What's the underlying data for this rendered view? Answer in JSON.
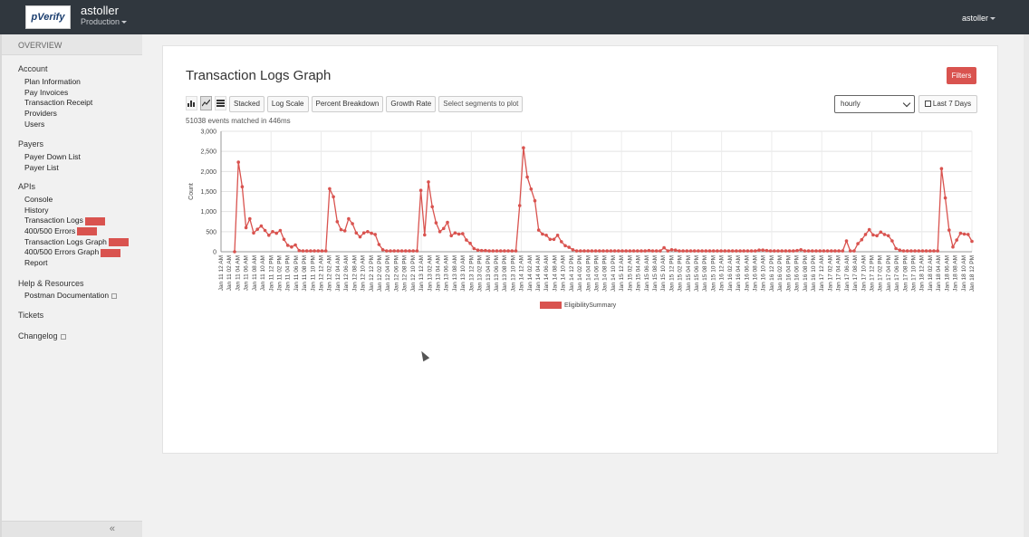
{
  "header": {
    "logo_text": "pVerify",
    "account_name": "astoller",
    "environment": "Production",
    "user_name": "astoller"
  },
  "sidebar": {
    "overview": "OVERVIEW",
    "account": {
      "title": "Account",
      "items": [
        "Plan Information",
        "Pay Invoices",
        "Transaction Receipt",
        "Providers",
        "Users"
      ]
    },
    "payers": {
      "title": "Payers",
      "items": [
        "Payer Down List",
        "Payer List"
      ]
    },
    "apis": {
      "title": "APIs",
      "items": [
        "Console",
        "History",
        "Transaction Logs",
        "400/500 Errors",
        "Transaction Logs Graph",
        "400/500 Errors Graph",
        "Report"
      ]
    },
    "help": {
      "title": "Help & Resources",
      "items": [
        "Postman Documentation"
      ]
    },
    "tickets": "Tickets",
    "changelog": "Changelog",
    "collapse": "«"
  },
  "main": {
    "title": "Transaction Logs Graph",
    "filters_label": "Filters",
    "toolbar": {
      "stacked": "Stacked",
      "log_scale": "Log Scale",
      "percent_breakdown": "Percent Breakdown",
      "growth_rate": "Growth Rate",
      "select_segments": "Select segments to plot"
    },
    "matched_text": "51038 events matched in 446ms",
    "interval": "hourly",
    "range": "Last 7 Days"
  },
  "chart_data": {
    "type": "line",
    "ylabel": "Count",
    "ylim": [
      0,
      3000
    ],
    "yticks": [
      "0",
      "500",
      "1,000",
      "1,500",
      "2,000",
      "2,500",
      "3,000"
    ],
    "grid": true,
    "legend_position": "bottom-center",
    "colors": {
      "series": "#d9534f"
    },
    "x_tick_labels": [
      "Jan 11 12 AM",
      "Jan 11 02 AM",
      "Jan 11 04 AM",
      "Jan 11 06 AM",
      "Jan 11 08 AM",
      "Jan 11 10 AM",
      "Jan 11 12 PM",
      "Jan 11 02 PM",
      "Jan 11 04 PM",
      "Jan 11 06 PM",
      "Jan 11 08 PM",
      "Jan 11 10 PM",
      "Jan 12 12 AM",
      "Jan 12 02 AM",
      "Jan 12 04 AM",
      "Jan 12 06 AM",
      "Jan 12 08 AM",
      "Jan 12 10 AM",
      "Jan 12 12 PM",
      "Jan 12 02 PM",
      "Jan 12 04 PM",
      "Jan 12 06 PM",
      "Jan 12 08 PM",
      "Jan 12 10 PM",
      "Jan 13 12 AM",
      "Jan 13 02 AM",
      "Jan 13 04 AM",
      "Jan 13 06 AM",
      "Jan 13 08 AM",
      "Jan 13 10 AM",
      "Jan 13 12 PM",
      "Jan 13 02 PM",
      "Jan 13 04 PM",
      "Jan 13 06 PM",
      "Jan 13 08 PM",
      "Jan 13 10 PM",
      "Jan 14 12 AM",
      "Jan 14 02 AM",
      "Jan 14 04 AM",
      "Jan 14 06 AM",
      "Jan 14 08 AM",
      "Jan 14 10 AM",
      "Jan 14 12 PM",
      "Jan 14 02 PM",
      "Jan 14 04 PM",
      "Jan 14 06 PM",
      "Jan 14 08 PM",
      "Jan 14 10 PM",
      "Jan 15 12 AM",
      "Jan 15 02 AM",
      "Jan 15 04 AM",
      "Jan 15 06 AM",
      "Jan 15 08 AM",
      "Jan 15 10 AM",
      "Jan 15 12 PM",
      "Jan 15 02 PM",
      "Jan 15 04 PM",
      "Jan 15 06 PM",
      "Jan 15 08 PM",
      "Jan 15 10 PM",
      "Jan 16 12 AM",
      "Jan 16 02 AM",
      "Jan 16 04 AM",
      "Jan 16 06 AM",
      "Jan 16 08 AM",
      "Jan 16 10 AM",
      "Jan 16 12 PM",
      "Jan 16 02 PM",
      "Jan 16 04 PM",
      "Jan 16 06 PM",
      "Jan 16 08 PM",
      "Jan 16 10 PM",
      "Jan 17 12 AM",
      "Jan 17 02 AM",
      "Jan 17 04 AM",
      "Jan 17 06 AM",
      "Jan 17 08 AM",
      "Jan 17 10 AM",
      "Jan 17 12 PM",
      "Jan 17 02 PM",
      "Jan 17 04 PM",
      "Jan 17 06 PM",
      "Jan 17 08 PM",
      "Jan 17 10 PM",
      "Jan 18 12 AM",
      "Jan 18 02 AM",
      "Jan 18 04 AM",
      "Jan 18 06 AM",
      "Jan 18 08 AM",
      "Jan 18 10 AM",
      "Jan 18 12 PM"
    ],
    "series": [
      {
        "name": "EligibilitySummary",
        "values": [
          0,
          2230,
          1620,
          600,
          820,
          470,
          560,
          640,
          530,
          410,
          500,
          460,
          530,
          310,
          160,
          120,
          170,
          30,
          20,
          20,
          20,
          20,
          20,
          20,
          20,
          1570,
          1370,
          750,
          550,
          520,
          820,
          700,
          470,
          370,
          470,
          500,
          460,
          430,
          180,
          50,
          20,
          20,
          20,
          20,
          20,
          20,
          20,
          20,
          20,
          1530,
          420,
          1740,
          1120,
          720,
          500,
          580,
          730,
          400,
          470,
          440,
          450,
          290,
          210,
          80,
          40,
          30,
          30,
          20,
          20,
          20,
          20,
          20,
          20,
          20,
          20,
          1150,
          2590,
          1860,
          1560,
          1270,
          540,
          440,
          410,
          310,
          310,
          410,
          250,
          150,
          110,
          50,
          20,
          20,
          20,
          20,
          20,
          20,
          20,
          20,
          20,
          20,
          20,
          20,
          20,
          20,
          20,
          20,
          20,
          20,
          20,
          30,
          20,
          20,
          20,
          100,
          20,
          50,
          40,
          20,
          20,
          20,
          20,
          20,
          20,
          20,
          20,
          20,
          20,
          20,
          20,
          20,
          20,
          20,
          20,
          20,
          20,
          20,
          20,
          20,
          40,
          40,
          30,
          20,
          20,
          20,
          20,
          20,
          20,
          20,
          30,
          50,
          20,
          20,
          20,
          20,
          20,
          20,
          20,
          20,
          20,
          20,
          20,
          270,
          20,
          20,
          200,
          300,
          430,
          550,
          420,
          400,
          490,
          430,
          400,
          270,
          80,
          40,
          20,
          20,
          20,
          20,
          20,
          20,
          20,
          20,
          20,
          20,
          2070,
          1340,
          540,
          120,
          290,
          460,
          440,
          430,
          260
        ]
      }
    ]
  }
}
